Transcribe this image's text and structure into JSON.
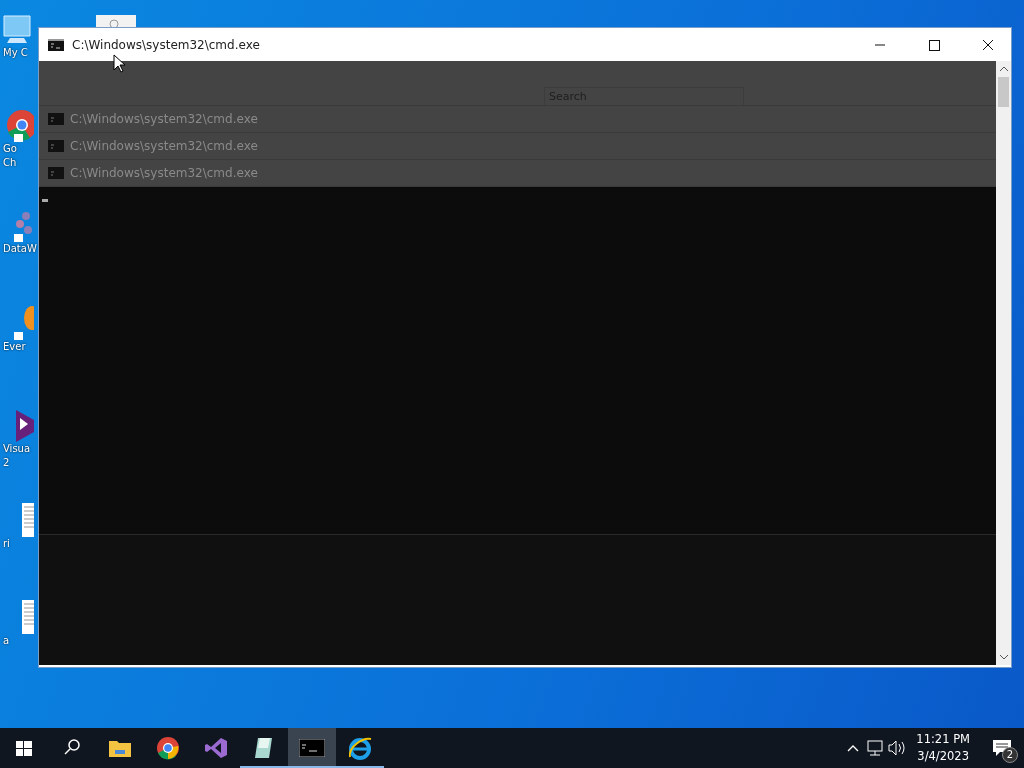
{
  "desktop_icons": [
    {
      "kind": "computer",
      "lines": [
        "My C"
      ]
    },
    {
      "kind": "chrome",
      "lines": [
        "Go",
        "Ch"
      ]
    },
    {
      "kind": "network",
      "lines": [
        "DataW"
      ]
    },
    {
      "kind": "orange",
      "lines": [
        "Ever"
      ]
    },
    {
      "kind": "vs",
      "lines": [
        "Visua",
        "2"
      ]
    },
    {
      "kind": "doc",
      "lines": [
        "ri"
      ]
    },
    {
      "kind": "doc",
      "lines": [
        "a"
      ]
    }
  ],
  "window": {
    "title": "C:\\Windows\\system32\\cmd.exe"
  },
  "ghost": {
    "search": {
      "placeholder": "Search"
    },
    "rows": [
      {
        "title": "C:\\Windows\\system32\\cmd.exe"
      },
      {
        "title": "C:\\Windows\\system32\\cmd.exe"
      },
      {
        "title": "C:\\Windows\\system32\\cmd.exe"
      }
    ]
  },
  "taskbar": {
    "apps": [
      {
        "kind": "explorer",
        "running": false,
        "selected": false
      },
      {
        "kind": "chrome",
        "running": false,
        "selected": false
      },
      {
        "kind": "vs",
        "running": false,
        "selected": false
      },
      {
        "kind": "notepad",
        "running": true,
        "selected": false
      },
      {
        "kind": "cmd",
        "running": true,
        "selected": true
      },
      {
        "kind": "ie",
        "running": true,
        "selected": false
      }
    ],
    "time": "11:21 PM",
    "date": "3/4/2023",
    "notifications": "2"
  }
}
